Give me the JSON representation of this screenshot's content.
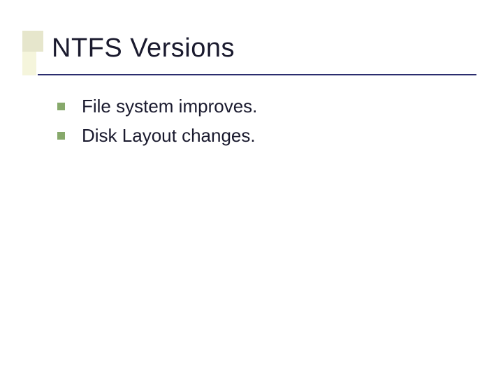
{
  "slide": {
    "title": "NTFS Versions",
    "bullets": [
      {
        "text": "File system improves."
      },
      {
        "text": "Disk Layout changes."
      }
    ]
  }
}
